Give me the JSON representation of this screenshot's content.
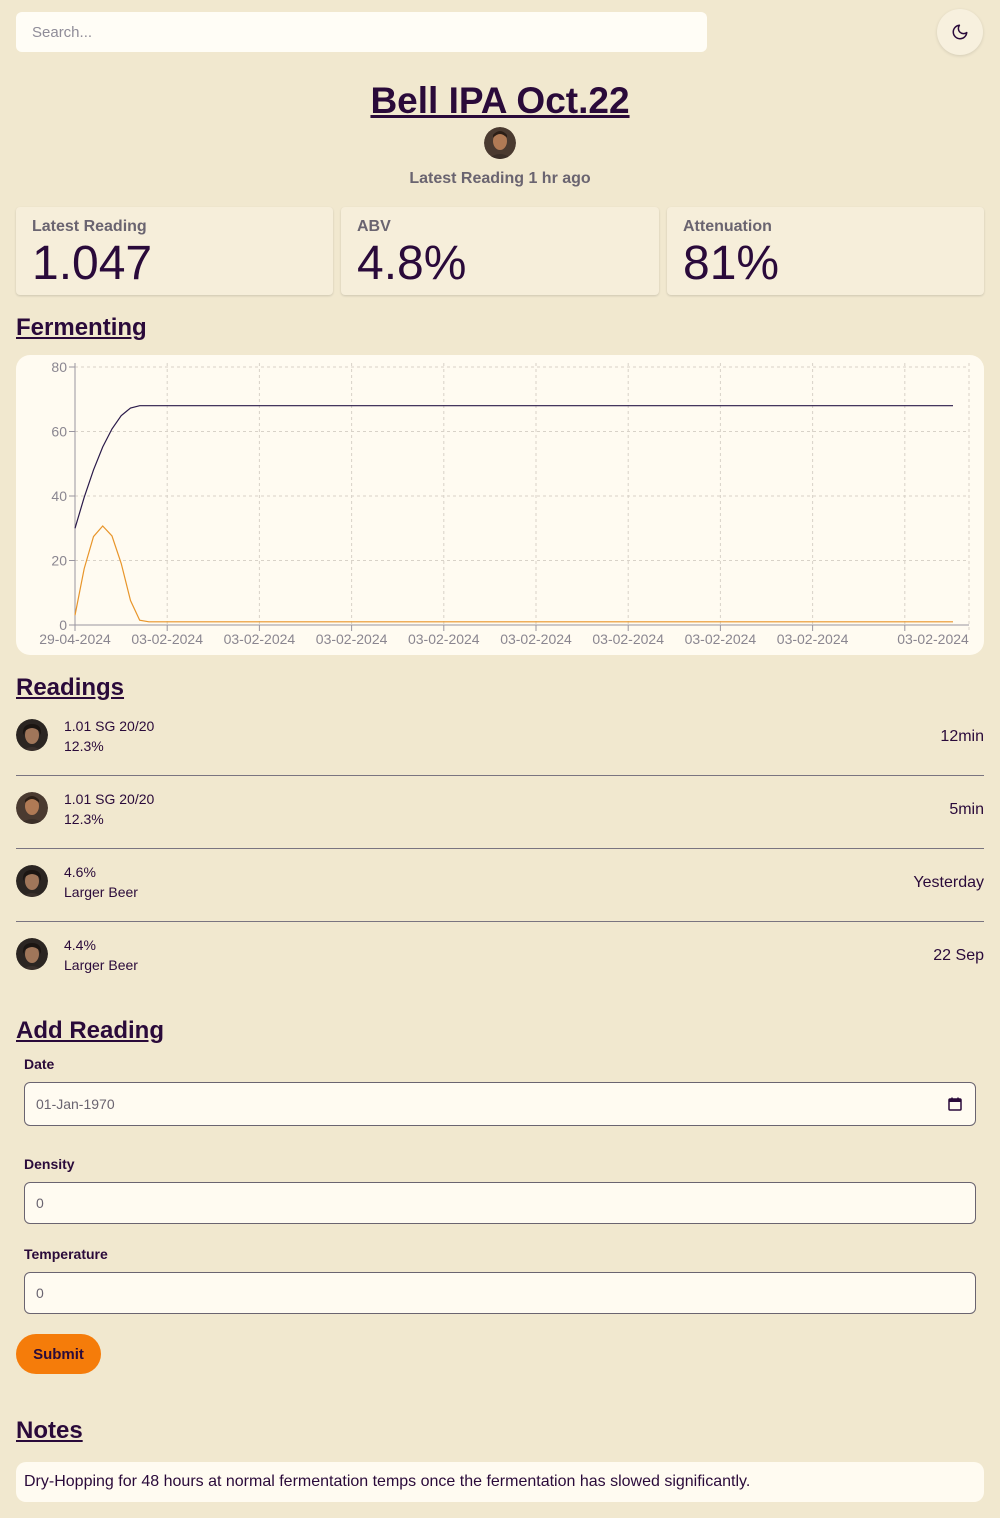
{
  "search": {
    "placeholder": "Search..."
  },
  "theme_toggle": {
    "icon": "moon-icon"
  },
  "header": {
    "title": "Bell IPA Oct.22",
    "subtitle": "Latest Reading 1 hr ago"
  },
  "stats": [
    {
      "label": "Latest Reading",
      "value": "1.047"
    },
    {
      "label": "ABV",
      "value": "4.8%"
    },
    {
      "label": "Attenuation",
      "value": "81%"
    }
  ],
  "colors": {
    "background": "#f1e8cf",
    "text": "#2a0a3a",
    "accent": "#f57c0a",
    "series_dark": "#2a1a4a",
    "series_orange": "#e8952a"
  },
  "sections": {
    "fermenting": "Fermenting",
    "readings": "Readings",
    "add_reading": "Add Reading",
    "notes": "Notes"
  },
  "chart_data": {
    "type": "line",
    "title": "",
    "xlabel": "",
    "ylabel": "",
    "ylim": [
      0,
      80
    ],
    "yticks": [
      0,
      20,
      40,
      60,
      80
    ],
    "xtick_labels": [
      "29-04-2024",
      "03-02-2024",
      "03-02-2024",
      "03-02-2024",
      "03-02-2024",
      "03-02-2024",
      "03-02-2024",
      "03-02-2024",
      "03-02-2024",
      "03-02-2024"
    ],
    "grid": true,
    "x": [
      0,
      0.1,
      0.2,
      0.3,
      0.4,
      0.5,
      0.6,
      0.7,
      0.8,
      0.9,
      1.0,
      1.5,
      2,
      3,
      4,
      5,
      6,
      7,
      8,
      9,
      9.5
    ],
    "series": [
      {
        "color": "#2a1a4a",
        "values": [
          30,
          39.6,
          48.1,
          55.2,
          60.8,
          64.9,
          67.3,
          68,
          68,
          68,
          68,
          68,
          68,
          68,
          68,
          68,
          68,
          68,
          68,
          68,
          68
        ]
      },
      {
        "color": "#e8952a",
        "values": [
          3,
          17.5,
          27.4,
          30.7,
          27.6,
          19.1,
          7.6,
          1.5,
          1,
          1,
          1,
          1,
          1,
          1,
          1,
          1,
          1,
          1,
          1,
          1,
          1
        ]
      }
    ]
  },
  "readings": [
    {
      "line1": "1.01 SG 20/20",
      "line2": "12.3%",
      "time": "12min",
      "avatar": "woman-avatar"
    },
    {
      "line1": "1.01 SG 20/20",
      "line2": "12.3%",
      "time": "5min",
      "avatar": "man-avatar"
    },
    {
      "line1": "4.6%",
      "line2": "Larger Beer",
      "time": "Yesterday",
      "avatar": "woman-avatar"
    },
    {
      "line1": "4.4%",
      "line2": "Larger Beer",
      "time": "22 Sep",
      "avatar": "woman-avatar"
    }
  ],
  "form": {
    "date_label": "Date",
    "date_value": "01-Jan-1970",
    "density_label": "Density",
    "density_value": "0",
    "temperature_label": "Temperature",
    "temperature_value": "0",
    "submit_label": "Submit"
  },
  "notes": {
    "text": "Dry-Hopping for 48 hours at normal fermentation temps once the fermentation has slowed significantly."
  }
}
